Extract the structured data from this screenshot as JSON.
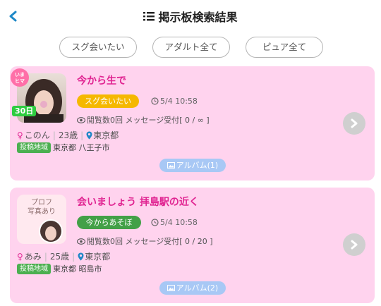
{
  "header": {
    "title": "掲示板検索結果"
  },
  "filters": [
    "スグ会いたい",
    "アダルト全て",
    "ピュア全て"
  ],
  "posts": [
    {
      "title": "今から生で",
      "tag": "スグ会いたい",
      "tag_color": "#f5b800",
      "time": "5/4 10:58",
      "stats": "閲覧数0回 メッセージ受付[ 0 / ∞ ]",
      "name": "このん",
      "age": "23歳",
      "location": "東京都",
      "area_label": "投稿地域",
      "area": "東京都 八王子市",
      "album": "アルバム(1)",
      "badge": "いまヒマ",
      "count_badge": "30日"
    },
    {
      "title": "会いましょう 拝島駅の近く",
      "tag": "今からあそぼ",
      "tag_color": "#43a047",
      "time": "5/4 10:58",
      "stats": "閲覧数0回 メッセージ受付[ 0 / 20 ]",
      "name": "あみ",
      "age": "25歳",
      "location": "東京都",
      "area_label": "投稿地域",
      "area": "東京都 昭島市",
      "album": "アルバム(2)",
      "profile_label": "プロフ写真あり"
    }
  ],
  "colors": {
    "card_bg": "#ffd3ee",
    "title": "#e02491",
    "back": "#1e88c7"
  }
}
